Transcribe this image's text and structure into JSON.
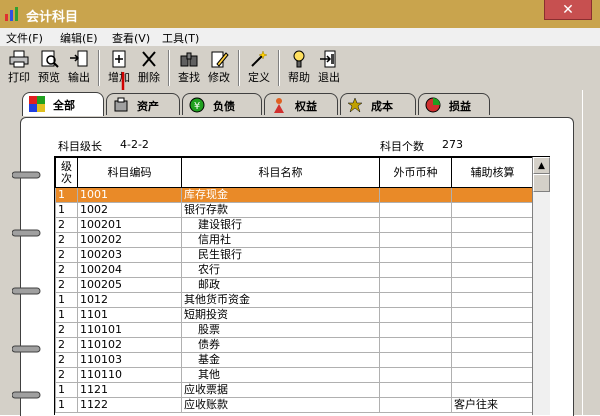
{
  "window": {
    "title": "会计科目",
    "close_glyph": "✕"
  },
  "menu": [
    "文件(F)",
    "编辑(E)",
    "查看(V)",
    "工具(T)"
  ],
  "toolbar": [
    {
      "label": "打印",
      "icon": "printer-icon"
    },
    {
      "label": "预览",
      "icon": "preview-icon"
    },
    {
      "label": "输出",
      "icon": "export-icon"
    },
    {
      "label": "增加",
      "icon": "add-doc-icon"
    },
    {
      "label": "删除",
      "icon": "delete-x-icon"
    },
    {
      "label": "查找",
      "icon": "find-icon"
    },
    {
      "label": "修改",
      "icon": "edit-icon"
    },
    {
      "label": "定义",
      "icon": "wand-icon"
    },
    {
      "label": "帮助",
      "icon": "help-icon"
    },
    {
      "label": "退出",
      "icon": "exit-icon"
    }
  ],
  "tabs": [
    {
      "label": "全部",
      "icon": "all-icon",
      "active": true
    },
    {
      "label": "资产",
      "icon": "asset-icon",
      "active": false
    },
    {
      "label": "负债",
      "icon": "liability-icon",
      "active": false
    },
    {
      "label": "权益",
      "icon": "equity-icon",
      "active": false
    },
    {
      "label": "成本",
      "icon": "cost-icon",
      "active": false
    },
    {
      "label": "损益",
      "icon": "profit-loss-icon",
      "active": false
    }
  ],
  "info": {
    "level_label": "科目级长",
    "level_value": "4-2-2",
    "count_label": "科目个数",
    "count_value": "273"
  },
  "grid": {
    "headers": [
      "级次",
      "科目编码",
      "科目名称",
      "外币币种",
      "辅助核算"
    ],
    "rows": [
      {
        "level": "1",
        "code": "1001",
        "name": "库存现金",
        "indent": 0,
        "currency": "",
        "aux": "",
        "selected": true
      },
      {
        "level": "1",
        "code": "1002",
        "name": "银行存款",
        "indent": 0,
        "currency": "",
        "aux": ""
      },
      {
        "level": "2",
        "code": "100201",
        "name": "建设银行",
        "indent": 1,
        "currency": "",
        "aux": ""
      },
      {
        "level": "2",
        "code": "100202",
        "name": "信用社",
        "indent": 1,
        "currency": "",
        "aux": ""
      },
      {
        "level": "2",
        "code": "100203",
        "name": "民生银行",
        "indent": 1,
        "currency": "",
        "aux": ""
      },
      {
        "level": "2",
        "code": "100204",
        "name": "农行",
        "indent": 1,
        "currency": "",
        "aux": ""
      },
      {
        "level": "2",
        "code": "100205",
        "name": "邮政",
        "indent": 1,
        "currency": "",
        "aux": ""
      },
      {
        "level": "1",
        "code": "1012",
        "name": "其他货币资金",
        "indent": 0,
        "currency": "",
        "aux": ""
      },
      {
        "level": "1",
        "code": "1101",
        "name": "短期投资",
        "indent": 0,
        "currency": "",
        "aux": ""
      },
      {
        "level": "2",
        "code": "110101",
        "name": "股票",
        "indent": 1,
        "currency": "",
        "aux": ""
      },
      {
        "level": "2",
        "code": "110102",
        "name": "债券",
        "indent": 1,
        "currency": "",
        "aux": ""
      },
      {
        "level": "2",
        "code": "110103",
        "name": "基金",
        "indent": 1,
        "currency": "",
        "aux": ""
      },
      {
        "level": "2",
        "code": "110110",
        "name": "其他",
        "indent": 1,
        "currency": "",
        "aux": ""
      },
      {
        "level": "1",
        "code": "1121",
        "name": "应收票据",
        "indent": 0,
        "currency": "",
        "aux": ""
      },
      {
        "level": "1",
        "code": "1122",
        "name": "应收账款",
        "indent": 0,
        "currency": "",
        "aux": "客户往来"
      }
    ]
  },
  "scroll": {
    "up_glyph": "▲"
  },
  "colors": {
    "titlebar": "#c9a44d",
    "selected_row": "#e98a28",
    "panel": "#d4d0c8"
  }
}
